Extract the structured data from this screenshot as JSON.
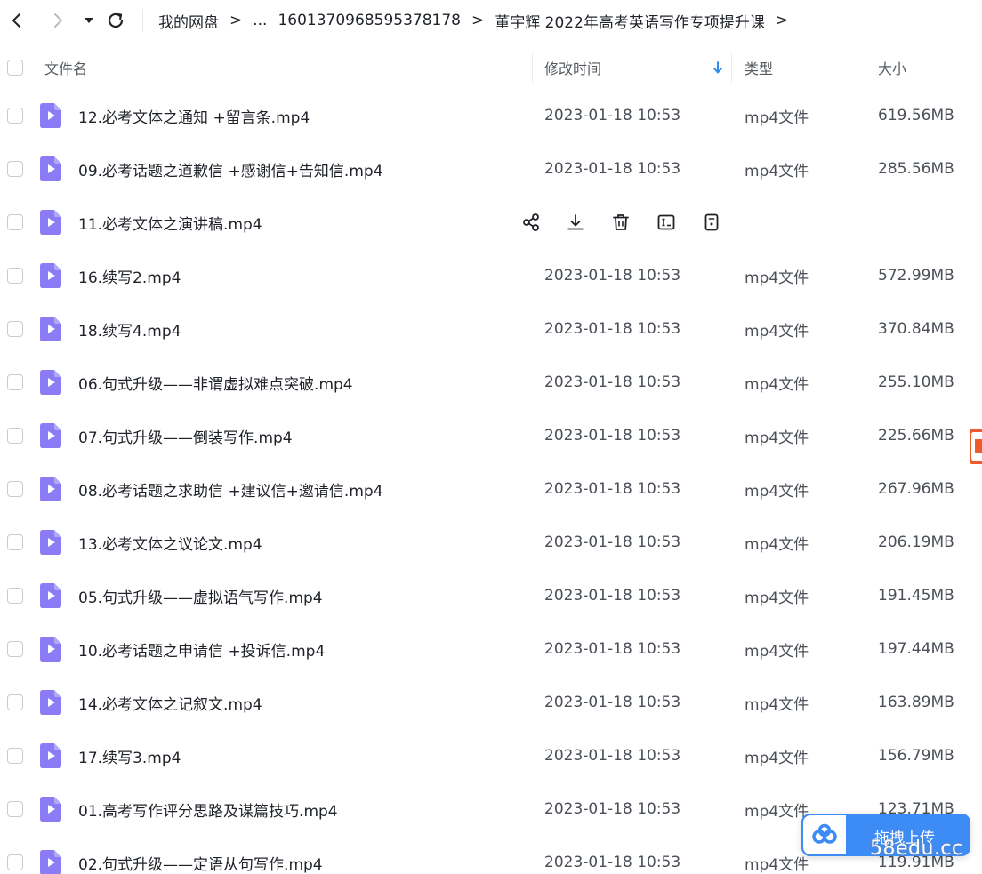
{
  "breadcrumb": {
    "items": [
      "我的网盘",
      "...",
      "1601370968595378178",
      "董宇辉 2022年高考英语写作专项提升课"
    ],
    "separator": ">"
  },
  "columns": {
    "name": "文件名",
    "modified": "修改时间",
    "type": "类型",
    "size": "大小"
  },
  "files": [
    {
      "name": "12.必考文体之通知 +留言条.mp4",
      "date": "2023-01-18 10:53",
      "type": "mp4文件",
      "size": "619.56MB"
    },
    {
      "name": "09.必考话题之道歉信 +感谢信+告知信.mp4",
      "date": "2023-01-18 10:53",
      "type": "mp4文件",
      "size": "285.56MB"
    },
    {
      "name": "11.必考文体之演讲稿.mp4",
      "date": "",
      "type": "",
      "size": ""
    },
    {
      "name": "16.续写2.mp4",
      "date": "2023-01-18 10:53",
      "type": "mp4文件",
      "size": "572.99MB"
    },
    {
      "name": "18.续写4.mp4",
      "date": "2023-01-18 10:53",
      "type": "mp4文件",
      "size": "370.84MB"
    },
    {
      "name": "06.句式升级——非谓虚拟难点突破.mp4",
      "date": "2023-01-18 10:53",
      "type": "mp4文件",
      "size": "255.10MB"
    },
    {
      "name": "07.句式升级——倒装写作.mp4",
      "date": "2023-01-18 10:53",
      "type": "mp4文件",
      "size": "225.66MB"
    },
    {
      "name": "08.必考话题之求助信 +建议信+邀请信.mp4",
      "date": "2023-01-18 10:53",
      "type": "mp4文件",
      "size": "267.96MB"
    },
    {
      "name": "13.必考文体之议论文.mp4",
      "date": "2023-01-18 10:53",
      "type": "mp4文件",
      "size": "206.19MB"
    },
    {
      "name": "05.句式升级——虚拟语气写作.mp4",
      "date": "2023-01-18 10:53",
      "type": "mp4文件",
      "size": "191.45MB"
    },
    {
      "name": "10.必考话题之申请信 +投诉信.mp4",
      "date": "2023-01-18 10:53",
      "type": "mp4文件",
      "size": "197.44MB"
    },
    {
      "name": "14.必考文体之记叙文.mp4",
      "date": "2023-01-18 10:53",
      "type": "mp4文件",
      "size": "163.89MB"
    },
    {
      "name": "17.续写3.mp4",
      "date": "2023-01-18 10:53",
      "type": "mp4文件",
      "size": "156.79MB"
    },
    {
      "name": "01.高考写作评分思路及谋篇技巧.mp4",
      "date": "2023-01-18 10:53",
      "type": "mp4文件",
      "size": "123.71MB"
    },
    {
      "name": "02.句式升级——定语从句写作.mp4",
      "date": "2023-01-18 10:53",
      "type": "mp4文件",
      "size": "119.91MB"
    }
  ],
  "hover_actions": [
    "share-icon",
    "download-icon",
    "delete-icon",
    "rename-icon",
    "more-icon"
  ],
  "upload": {
    "label": "拖拽上传"
  },
  "watermark": "58edu.cc",
  "colors": {
    "accent": "#3d8bf5",
    "file_icon": "#8b7cf6",
    "sort_arrow": "#2f8ff0"
  }
}
